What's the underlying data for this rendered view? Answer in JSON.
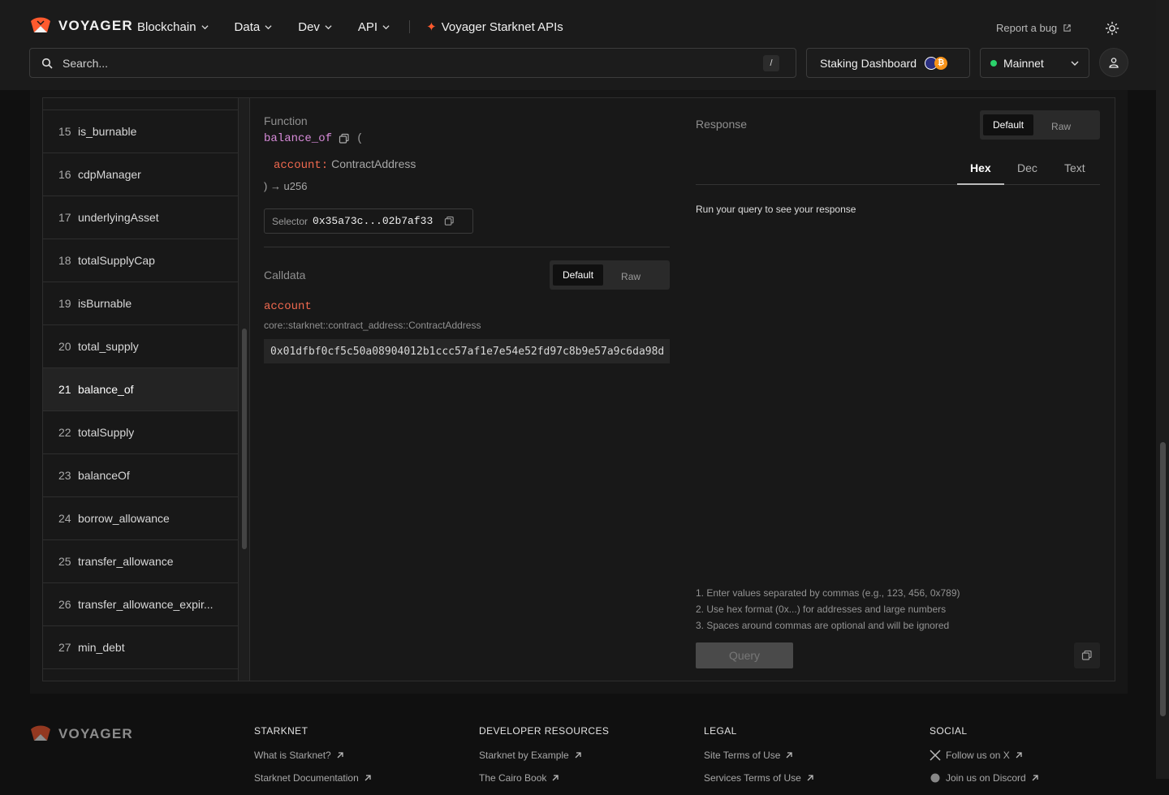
{
  "header": {
    "logo_text": "VOYAGER",
    "nav": [
      {
        "label": "Blockchain"
      },
      {
        "label": "Data"
      },
      {
        "label": "Dev"
      },
      {
        "label": "API"
      }
    ],
    "special_link": "Voyager Starknet APIs",
    "report_bug": "Report a bug",
    "search_placeholder": "Search...",
    "search_shortcut": "/",
    "staking_label": "Staking Dashboard",
    "network": "Mainnet"
  },
  "functions": [
    {
      "num": "15",
      "name": "is_burnable"
    },
    {
      "num": "16",
      "name": "cdpManager"
    },
    {
      "num": "17",
      "name": "underlyingAsset"
    },
    {
      "num": "18",
      "name": "totalSupplyCap"
    },
    {
      "num": "19",
      "name": "isBurnable"
    },
    {
      "num": "20",
      "name": "total_supply"
    },
    {
      "num": "21",
      "name": "balance_of"
    },
    {
      "num": "22",
      "name": "totalSupply"
    },
    {
      "num": "23",
      "name": "balanceOf"
    },
    {
      "num": "24",
      "name": "borrow_allowance"
    },
    {
      "num": "25",
      "name": "transfer_allowance"
    },
    {
      "num": "26",
      "name": "transfer_allowance_expir..."
    },
    {
      "num": "27",
      "name": "min_debt"
    }
  ],
  "function_panel": {
    "label": "Function",
    "name": "balance_of",
    "open_paren": "(",
    "arg_name": "account:",
    "arg_type": "ContractAddress",
    "return_line": ") → u256",
    "selector_label": "Selector",
    "selector_value": "0x35a73c...02b7af33",
    "calldata_label": "Calldata",
    "toggle_default": "Default",
    "toggle_raw": "Raw",
    "param_name": "account",
    "param_type": "core::starknet::contract_address::ContractAddress",
    "param_value": "0x01dfbf0cf5c50a08904012b1ccc57af1e7e54e52fd97c8b9e57a9c6da98d"
  },
  "response_panel": {
    "label": "Response",
    "toggle_default": "Default",
    "toggle_raw": "Raw",
    "tabs": [
      "Hex",
      "Dec",
      "Text"
    ],
    "active_tab": "Hex",
    "empty_text": "Run your query to see your response",
    "tips": [
      "1. Enter values separated by commas (e.g., 123, 456, 0x789)",
      "2. Use hex format (0x...) for addresses and large numbers",
      "3. Spaces around commas are optional and will be ignored"
    ],
    "query_label": "Query"
  },
  "footer": {
    "logo_text": "VOYAGER",
    "columns": [
      {
        "title": "STARKNET",
        "links": [
          "What is Starknet?",
          "Starknet Documentation"
        ]
      },
      {
        "title": "DEVELOPER RESOURCES",
        "links": [
          "Starknet by Example",
          "The Cairo Book"
        ]
      },
      {
        "title": "LEGAL",
        "links": [
          "Site Terms of Use",
          "Services Terms of Use"
        ]
      },
      {
        "title": "SOCIAL",
        "links": [
          "Follow us on X",
          "Join us on Discord"
        ]
      }
    ]
  },
  "colors": {
    "accent_orange": "#ff5a2e",
    "function_name": "#d78bd9",
    "argument": "#f0694f",
    "network_dot": "#2bd26b"
  }
}
